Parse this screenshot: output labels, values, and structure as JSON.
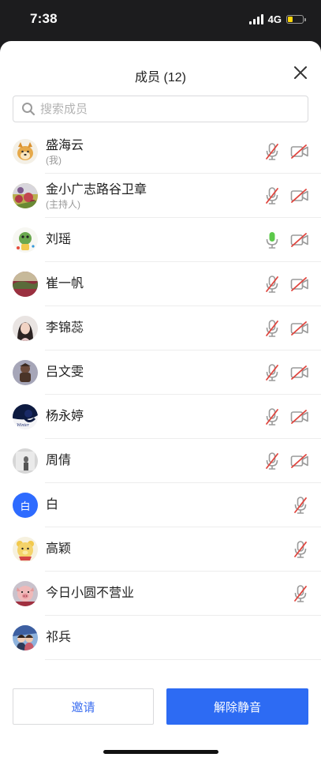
{
  "status_bar": {
    "time": "7:38",
    "network": "4G"
  },
  "sheet": {
    "title": "成员 (12)"
  },
  "search": {
    "placeholder": "搜索成员",
    "value": ""
  },
  "members": [
    {
      "name": "盛海云",
      "sub": "(我)",
      "mic": "muted",
      "camera": "off",
      "avatar": "dog"
    },
    {
      "name": "金小广志路谷卫章",
      "sub": "(主持人)",
      "mic": "muted",
      "camera": "off",
      "avatar": "flowers"
    },
    {
      "name": "刘瑶",
      "sub": "",
      "mic": "active",
      "camera": "off",
      "avatar": "cartoon"
    },
    {
      "name": "崔一帆",
      "sub": "",
      "mic": "muted",
      "camera": "off",
      "avatar": "landscape"
    },
    {
      "name": "李锦蕊",
      "sub": "",
      "mic": "muted",
      "camera": "off",
      "avatar": "portrait"
    },
    {
      "name": "吕文雯",
      "sub": "",
      "mic": "muted",
      "camera": "off",
      "avatar": "figure"
    },
    {
      "name": "杨永婷",
      "sub": "",
      "mic": "muted",
      "camera": "off",
      "avatar": "silhouette"
    },
    {
      "name": "周倩",
      "sub": "",
      "mic": "muted",
      "camera": "off",
      "avatar": "grey"
    },
    {
      "name": "白",
      "sub": "",
      "mic": "muted",
      "camera": "none",
      "avatar": "text",
      "avatar_text": "白"
    },
    {
      "name": "高颖",
      "sub": "",
      "mic": "muted",
      "camera": "none",
      "avatar": "bear"
    },
    {
      "name": "今日小圆不营业",
      "sub": "",
      "mic": "muted",
      "camera": "none",
      "avatar": "pig"
    },
    {
      "name": "祁兵",
      "sub": "",
      "mic": "none",
      "camera": "none",
      "avatar": "couple"
    }
  ],
  "buttons": {
    "invite": "邀请",
    "unmute_all": "解除静音"
  },
  "colors": {
    "accent": "#2d6bf3",
    "muted_red": "#e0463f",
    "mic_active_green": "#5cc94a"
  }
}
